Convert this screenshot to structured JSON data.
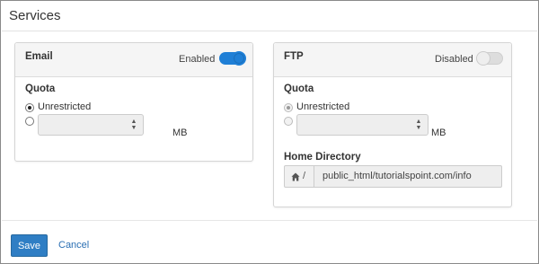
{
  "page": {
    "title": "Services"
  },
  "email": {
    "title": "Email",
    "status_label": "Enabled",
    "enabled": true,
    "quota": {
      "label": "Quota",
      "unrestricted_label": "Unrestricted",
      "unrestricted_selected": true,
      "custom_value": "",
      "unit": "MB"
    }
  },
  "ftp": {
    "title": "FTP",
    "status_label": "Disabled",
    "enabled": false,
    "quota": {
      "label": "Quota",
      "unrestricted_label": "Unrestricted",
      "unrestricted_selected": true,
      "custom_value": "",
      "unit": "MB"
    },
    "home_directory": {
      "label": "Home Directory",
      "prefix": "/",
      "value": "public_html/tutorialspoint.com/info"
    }
  },
  "footer": {
    "save_label": "Save",
    "cancel_label": "Cancel"
  },
  "colors": {
    "accent": "#2f7ec4",
    "toggle_on": "#1f7fd6",
    "link": "#2a6fb3"
  }
}
